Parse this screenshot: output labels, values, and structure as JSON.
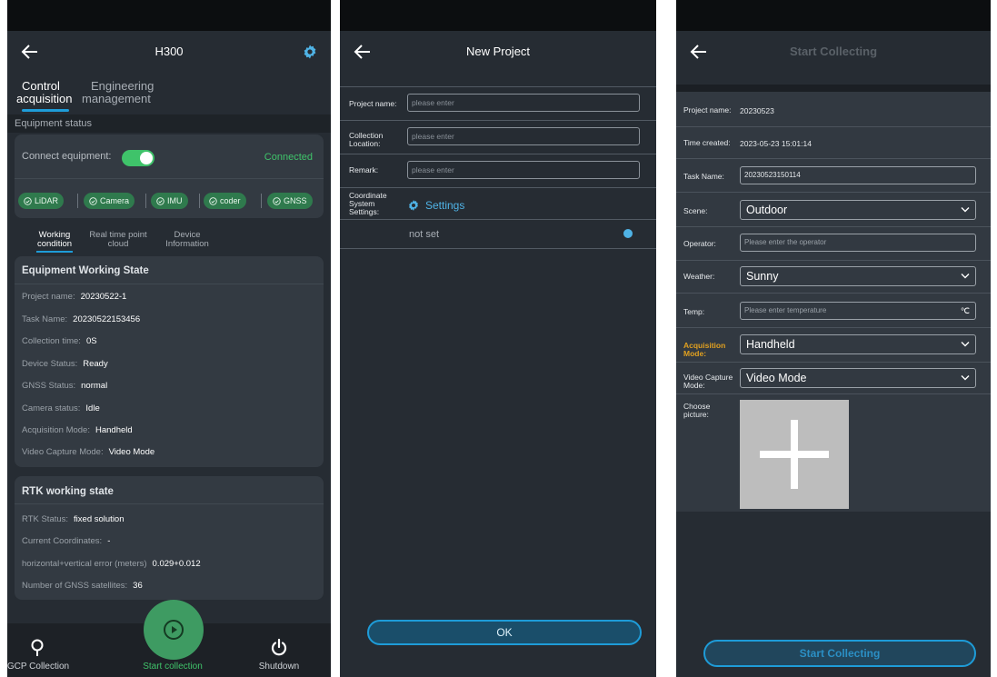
{
  "screen1": {
    "title": "H300",
    "tabs": [
      {
        "line1": "Control",
        "line2": "acquisition"
      },
      {
        "line1": "Engineering",
        "line2": "management"
      }
    ],
    "section_label": "Equipment status",
    "connect_label": "Connect equipment:",
    "connect_status": "Connected",
    "chips": [
      "LiDAR",
      "Camera",
      "IMU",
      "coder",
      "GNSS"
    ],
    "subtabs": [
      {
        "line1": "Working",
        "line2": "condition"
      },
      {
        "line1": "Real time point",
        "line2": "cloud"
      },
      {
        "line1": "Device",
        "line2": "Information"
      }
    ],
    "working_state": {
      "title": "Equipment Working State",
      "rows": [
        {
          "label": "Project name:",
          "value": "20230522-1"
        },
        {
          "label": "Task Name:",
          "value": "20230522153456"
        },
        {
          "label": "Collection time:",
          "value": "0S"
        },
        {
          "label": "Device Status:",
          "value": "Ready"
        },
        {
          "label": "GNSS Status:",
          "value": "normal"
        },
        {
          "label": "Camera status:",
          "value": "Idle"
        },
        {
          "label": "Acquisition Mode:",
          "value": "Handheld"
        },
        {
          "label": "Video Capture Mode:",
          "value": "Video Mode"
        }
      ]
    },
    "rtk_state": {
      "title": "RTK working state",
      "rows": [
        {
          "label": "RTK Status:",
          "value": "fixed solution"
        },
        {
          "label": "Current Coordinates:",
          "value": "-"
        },
        {
          "label": "horizontal+vertical error (meters)",
          "value": "0.029+0.012"
        },
        {
          "label": "Number of GNSS satellites:",
          "value": "36"
        }
      ]
    },
    "bottom_nav": {
      "gcp": "GCP Collection",
      "start": "Start collection",
      "shutdown": "Shutdown"
    }
  },
  "screen2": {
    "title": "New Project",
    "fields": [
      {
        "label": "Project name:",
        "placeholder": "please enter"
      },
      {
        "label1": "Collection",
        "label2": "Location:",
        "placeholder": "please enter"
      },
      {
        "label": "Remark:",
        "placeholder": "please enter"
      }
    ],
    "coord_label": [
      "Coordinate",
      "System",
      "Settings:"
    ],
    "settings_link": "Settings",
    "not_set": "not set",
    "ok_button": "OK"
  },
  "screen3": {
    "title": "Start Collecting",
    "project_name_label": "Project name:",
    "project_name": "20230523",
    "time_created_label": "Time created:",
    "time_created": "2023-05-23 15:01:14",
    "task_name_label": "Task Name:",
    "task_name": "20230523150114",
    "scene_label": "Scene:",
    "scene": "Outdoor",
    "operator_label": "Operator:",
    "operator_placeholder": "Please enter the operator",
    "weather_label": "Weather:",
    "weather": "Sunny",
    "temp_label": "Temp:",
    "temp_placeholder": "Please enter temperature",
    "temp_unit": "℃",
    "acq_label": [
      "Acquisition",
      "Mode:"
    ],
    "acq_mode": "Handheld",
    "video_label": [
      "Video Capture",
      "Mode:"
    ],
    "video_mode": "Video Mode",
    "choose_label": [
      "Choose",
      "picture:"
    ],
    "start_button": "Start Collecting"
  },
  "colors": {
    "accent": "#1e9cd8",
    "success": "#3fc36a",
    "background": "#262c33",
    "warning_label": "#e0a020"
  }
}
